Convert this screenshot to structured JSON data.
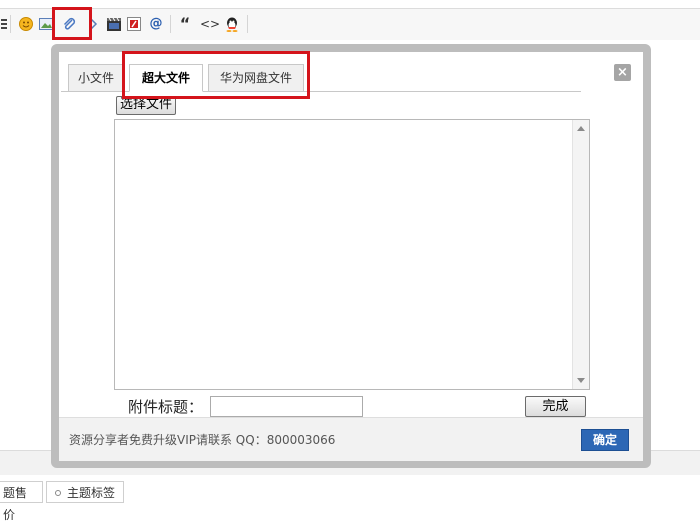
{
  "toolbar": {
    "icons": [
      "list-icon",
      "smiley-icon",
      "image-icon",
      "attachment-icon",
      "link-icon",
      "video-icon",
      "flash-icon",
      "at-icon",
      "quote-icon",
      "code-icon",
      "qq-icon"
    ],
    "quote_glyph": "“",
    "code_glyph": "<>",
    "at_glyph": "@"
  },
  "dialog": {
    "tabs": [
      {
        "label": "小文件",
        "active": false
      },
      {
        "label": "超大文件",
        "active": true
      },
      {
        "label": "华为网盘文件",
        "active": false
      }
    ],
    "close_label": "×",
    "choose_file_label": "选择文件",
    "caption_label": "附件标题：",
    "caption_value": "",
    "done_label": "完成",
    "notice": "资源分享者免费升级VIP请联系 QQ：800003066",
    "ok_label": "确定"
  },
  "bottom_tabs": [
    {
      "label": "题售价"
    },
    {
      "label": "主题标签"
    }
  ],
  "colors": {
    "highlight": "#d4141b",
    "primary_button": "#2c67b5",
    "dialog_frame": "#bdbdbd"
  }
}
